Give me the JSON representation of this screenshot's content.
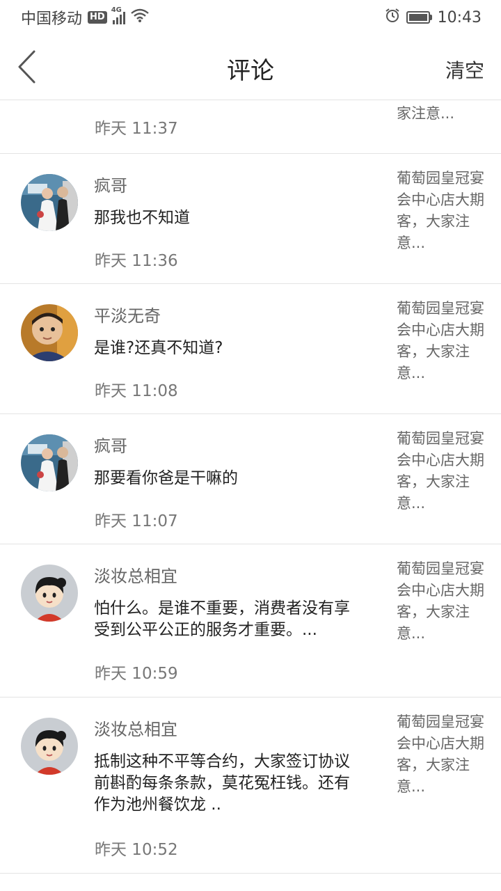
{
  "status_bar": {
    "carrier": "中国移动",
    "hd_badge": "HD",
    "network": "4G",
    "icons": [
      "hd-icon",
      "signal-icon",
      "wifi-icon",
      "alarm-icon",
      "battery-icon"
    ],
    "time": "10:43"
  },
  "header": {
    "back_icon": "chevron-left-icon",
    "title": "评论",
    "clear_label": "清空"
  },
  "comments": [
    {
      "author": "",
      "content": "",
      "time": "昨天 11:37",
      "post_preview": "家注意..."
    },
    {
      "author": "疯哥",
      "avatar": "wedding-photo",
      "content": "那我也不知道",
      "time": "昨天 11:36",
      "post_preview": "葡萄园皇冠宴会中心店大期客，大家注意..."
    },
    {
      "author": "平淡无奇",
      "avatar": "child-photo",
      "content": "是谁?还真不知道?",
      "time": "昨天 11:08",
      "post_preview": "葡萄园皇冠宴会中心店大期客，大家注意..."
    },
    {
      "author": "疯哥",
      "avatar": "wedding-photo",
      "content": "那要看你爸是干嘛的",
      "time": "昨天 11:07",
      "post_preview": "葡萄园皇冠宴会中心店大期客，大家注意..."
    },
    {
      "author": "淡妆总相宜",
      "avatar": "cartoon-girl",
      "content": "怕什么。是谁不重要，消费者没有享受到公平公正的服务才重要。...",
      "time": "昨天 10:59",
      "post_preview": "葡萄园皇冠宴会中心店大期客，大家注意..."
    },
    {
      "author": "淡妆总相宜",
      "avatar": "cartoon-girl",
      "content": "抵制这种不平等合约，大家签订协议前斟酌每条条款，莫花冤枉钱。还有作为池州餐饮龙 ..",
      "time": "昨天 10:52",
      "post_preview": "葡萄园皇冠宴会中心店大期客，大家注意..."
    }
  ],
  "colors": {
    "background": "#ffffff",
    "divider": "#e3e3e3",
    "primary_text": "#222222",
    "secondary_text": "#777777"
  }
}
